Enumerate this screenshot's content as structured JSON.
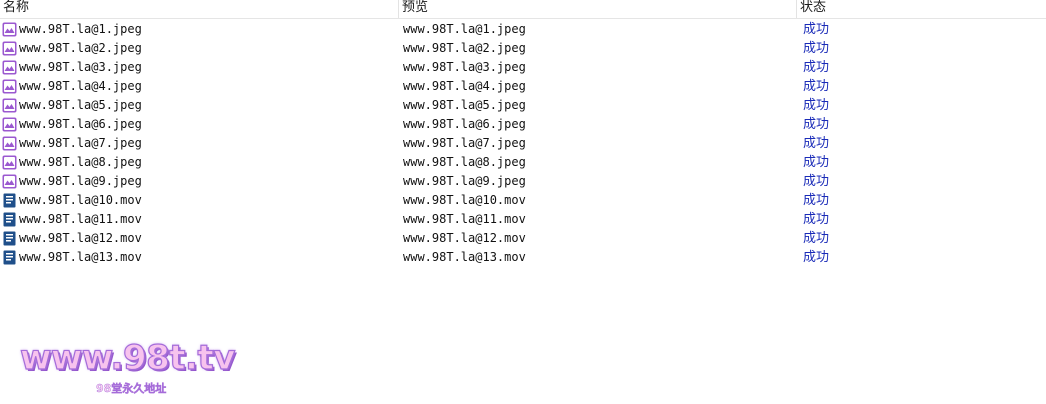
{
  "columns": {
    "name": "名称",
    "preview": "预览",
    "status": "状态"
  },
  "colors": {
    "status_text": "#1a2bb8",
    "image_icon": "#9b59d0",
    "video_icon": "#1f4f8a"
  },
  "rows": [
    {
      "name": "www.98T.la@1.jpeg",
      "preview": "www.98T.la@1.jpeg",
      "status": "成功",
      "icon": "image-file-icon"
    },
    {
      "name": "www.98T.la@2.jpeg",
      "preview": "www.98T.la@2.jpeg",
      "status": "成功",
      "icon": "image-file-icon"
    },
    {
      "name": "www.98T.la@3.jpeg",
      "preview": "www.98T.la@3.jpeg",
      "status": "成功",
      "icon": "image-file-icon"
    },
    {
      "name": "www.98T.la@4.jpeg",
      "preview": "www.98T.la@4.jpeg",
      "status": "成功",
      "icon": "image-file-icon"
    },
    {
      "name": "www.98T.la@5.jpeg",
      "preview": "www.98T.la@5.jpeg",
      "status": "成功",
      "icon": "image-file-icon"
    },
    {
      "name": "www.98T.la@6.jpeg",
      "preview": "www.98T.la@6.jpeg",
      "status": "成功",
      "icon": "image-file-icon"
    },
    {
      "name": "www.98T.la@7.jpeg",
      "preview": "www.98T.la@7.jpeg",
      "status": "成功",
      "icon": "image-file-icon"
    },
    {
      "name": "www.98T.la@8.jpeg",
      "preview": "www.98T.la@8.jpeg",
      "status": "成功",
      "icon": "image-file-icon"
    },
    {
      "name": "www.98T.la@9.jpeg",
      "preview": "www.98T.la@9.jpeg",
      "status": "成功",
      "icon": "image-file-icon"
    },
    {
      "name": "www.98T.la@10.mov",
      "preview": "www.98T.la@10.mov",
      "status": "成功",
      "icon": "video-file-icon"
    },
    {
      "name": "www.98T.la@11.mov",
      "preview": "www.98T.la@11.mov",
      "status": "成功",
      "icon": "video-file-icon"
    },
    {
      "name": "www.98T.la@12.mov",
      "preview": "www.98T.la@12.mov",
      "status": "成功",
      "icon": "video-file-icon"
    },
    {
      "name": "www.98T.la@13.mov",
      "preview": "www.98T.la@13.mov",
      "status": "成功",
      "icon": "video-file-icon"
    }
  ],
  "watermark": {
    "main": "www.98t.tv",
    "sub": "98堂永久地址"
  }
}
